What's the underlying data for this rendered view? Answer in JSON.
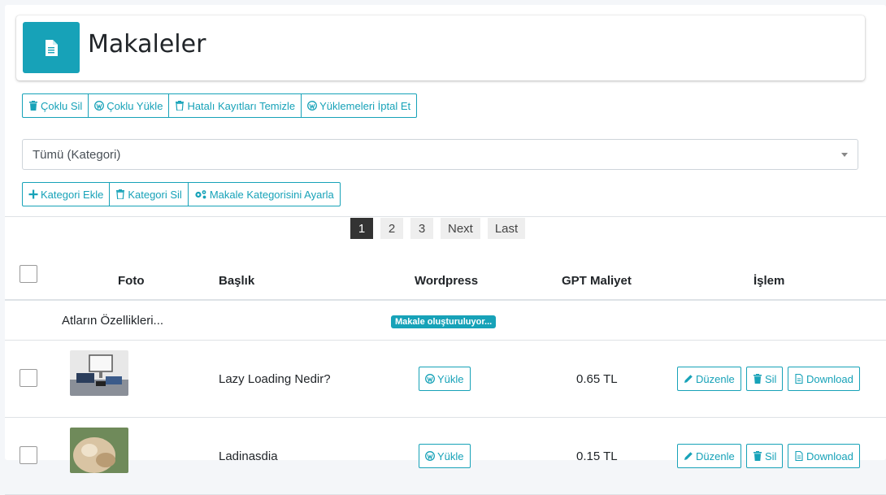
{
  "header": {
    "title": "Makaleler",
    "icon": "document-icon",
    "accent": "#17a2b8"
  },
  "toolbar1": [
    {
      "label": "Çoklu Sil",
      "icon": "trash-icon"
    },
    {
      "label": "Çoklu Yükle",
      "icon": "wordpress-icon"
    },
    {
      "label": "Hatalı Kayıtları Temizle",
      "icon": "trash-icon"
    },
    {
      "label": "Yüklemeleri İptal Et",
      "icon": "wordpress-icon"
    }
  ],
  "category_select": {
    "value": "Tümü (Kategori)"
  },
  "toolbar2": [
    {
      "label": "Kategori Ekle",
      "icon": "plus-icon"
    },
    {
      "label": "Kategori Sil",
      "icon": "trash-icon"
    },
    {
      "label": "Makale Kategorisini Ayarla",
      "icon": "cogs-icon"
    }
  ],
  "pagination": {
    "pages": [
      "1",
      "2",
      "3"
    ],
    "active": "1",
    "next": "Next",
    "last": "Last"
  },
  "table": {
    "headers": {
      "photo": "Foto",
      "title": "Başlık",
      "wordpress": "Wordpress",
      "cost": "GPT Maliyet",
      "action": "İşlem"
    },
    "generating_row": {
      "title": "Atların Özellikleri...",
      "status": "Makale oluşturuluyor..."
    },
    "rows": [
      {
        "title": "Lazy Loading Nedir?",
        "wp_button": "Yükle",
        "cost": "0.65 TL",
        "edit": "Düzenle",
        "delete": "Sil",
        "download": "Download"
      },
      {
        "title": "Ladinasdia",
        "wp_button": "Yükle",
        "cost": "0.15 TL",
        "edit": "Düzenle",
        "delete": "Sil",
        "download": "Download"
      }
    ]
  }
}
